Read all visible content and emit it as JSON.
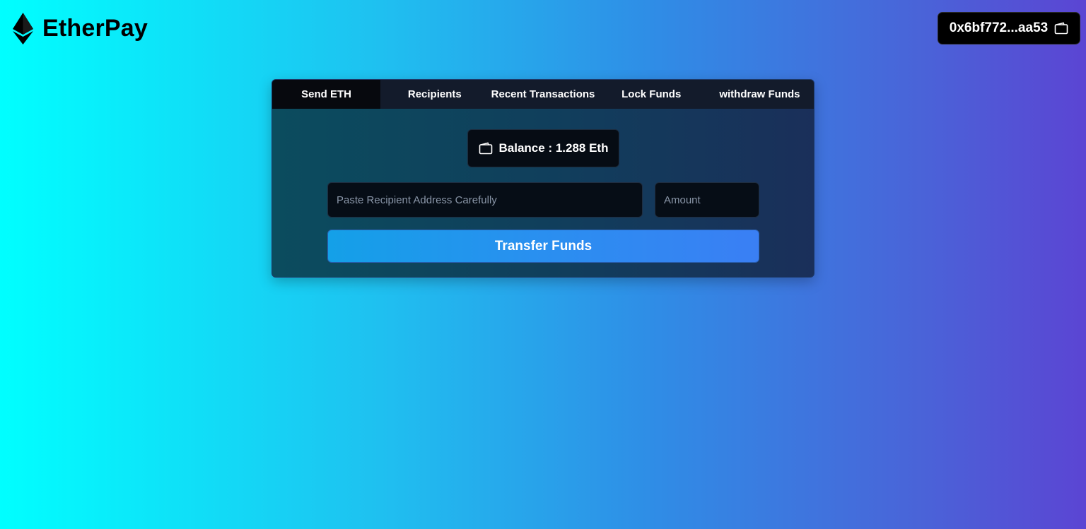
{
  "brand": {
    "name": "EtherPay",
    "logo_icon": "ethereum-icon"
  },
  "wallet": {
    "address": "0x6bf772...aa53",
    "icon": "wallet-icon"
  },
  "tabs": [
    {
      "label": "Send ETH",
      "active": true
    },
    {
      "label": "Recipients",
      "active": false
    },
    {
      "label": "Recent Transactions",
      "active": false
    },
    {
      "label": "Lock Funds",
      "active": false
    },
    {
      "label": "withdraw Funds",
      "active": false
    }
  ],
  "balance": {
    "label": "Balance : 1.288 Eth",
    "icon": "wallet-icon"
  },
  "form": {
    "recipient_placeholder": "Paste Recipient Address Carefully",
    "amount_placeholder": "Amount",
    "submit_label": "Transfer Funds"
  },
  "colors": {
    "background_start": "#00ffff",
    "background_end": "#5b45d3",
    "button_accent": "#2a8ff0",
    "active_tab": "#07090e"
  }
}
